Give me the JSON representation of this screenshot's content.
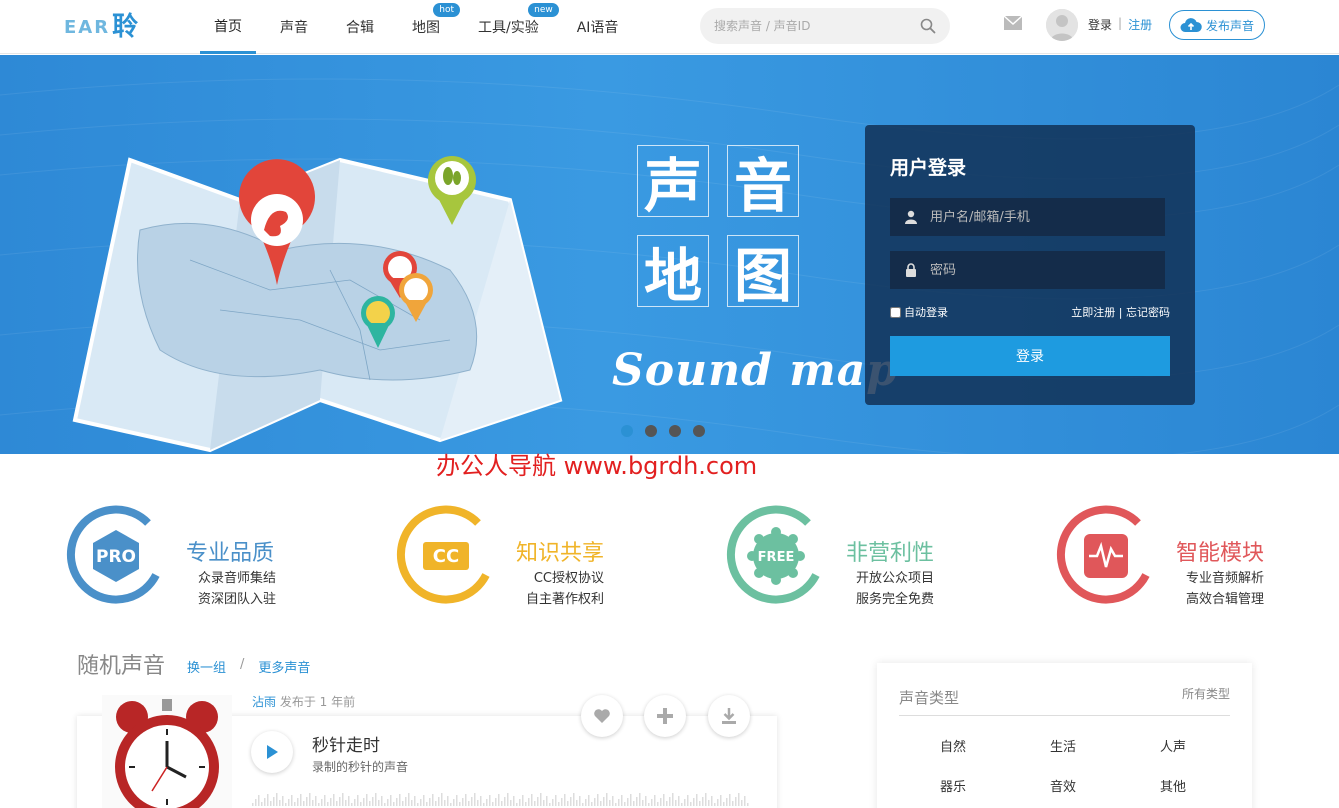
{
  "header": {
    "logo_text": "EAR",
    "logo_char": "聆",
    "nav": [
      {
        "label": "首页",
        "active": true,
        "badge": ""
      },
      {
        "label": "声音",
        "active": false,
        "badge": ""
      },
      {
        "label": "合辑",
        "active": false,
        "badge": ""
      },
      {
        "label": "地图",
        "active": false,
        "badge": "hot"
      },
      {
        "label": "工具/实验",
        "active": false,
        "badge": "new"
      },
      {
        "label": "AI语音",
        "active": false,
        "badge": ""
      }
    ],
    "search_placeholder": "搜索声音 / 声音ID",
    "login_label": "登录",
    "separator": "|",
    "register_label": "注册",
    "publish_label": "发布声音"
  },
  "banner": {
    "title_chars": [
      "声",
      "音",
      "地",
      "图"
    ],
    "subtitle": "Sound map",
    "login": {
      "title": "用户登录",
      "username_placeholder": "用户名/邮箱/手机",
      "password_placeholder": "密码",
      "remember_label": "自动登录",
      "register_link": "立即注册",
      "link_separator": "|",
      "forgot_link": "忘记密码",
      "submit_label": "登录"
    },
    "slide_count": 4,
    "active_slide": 0
  },
  "watermark": "办公人导航 www.bgrdh.com",
  "features": [
    {
      "badge": "PRO",
      "title": "专业品质",
      "line1": "众录音师集结",
      "line2": "资深团队入驻",
      "color": "#4a90c9"
    },
    {
      "badge": "CC",
      "title": "知识共享",
      "line1": "CC授权协议",
      "line2": "自主著作权利",
      "color": "#f0b429"
    },
    {
      "badge": "FREE",
      "title": "非营利性",
      "line1": "开放公众项目",
      "line2": "服务完全免费",
      "color": "#6cc0a0"
    },
    {
      "badge": "",
      "title": "智能模块",
      "line1": "专业音频解析",
      "line2": "高效合辑管理",
      "color": "#e0575a"
    }
  ],
  "random_sounds": {
    "title": "随机声音",
    "refresh_label": "换一组",
    "separator": "/",
    "more_label": "更多声音",
    "item": {
      "author": "沾雨",
      "published": "发布于 1 年前",
      "title": "秒针走时",
      "description": "录制的秒针的声音"
    }
  },
  "sound_types": {
    "title": "声音类型",
    "all_label": "所有类型",
    "items": [
      "自然",
      "生活",
      "人声",
      "器乐",
      "音效",
      "其他"
    ]
  },
  "colors": {
    "accent": "#2b91d4",
    "banner_bg": "#3a9ae2",
    "login_panel": "#102d50",
    "watermark": "#e22020"
  }
}
